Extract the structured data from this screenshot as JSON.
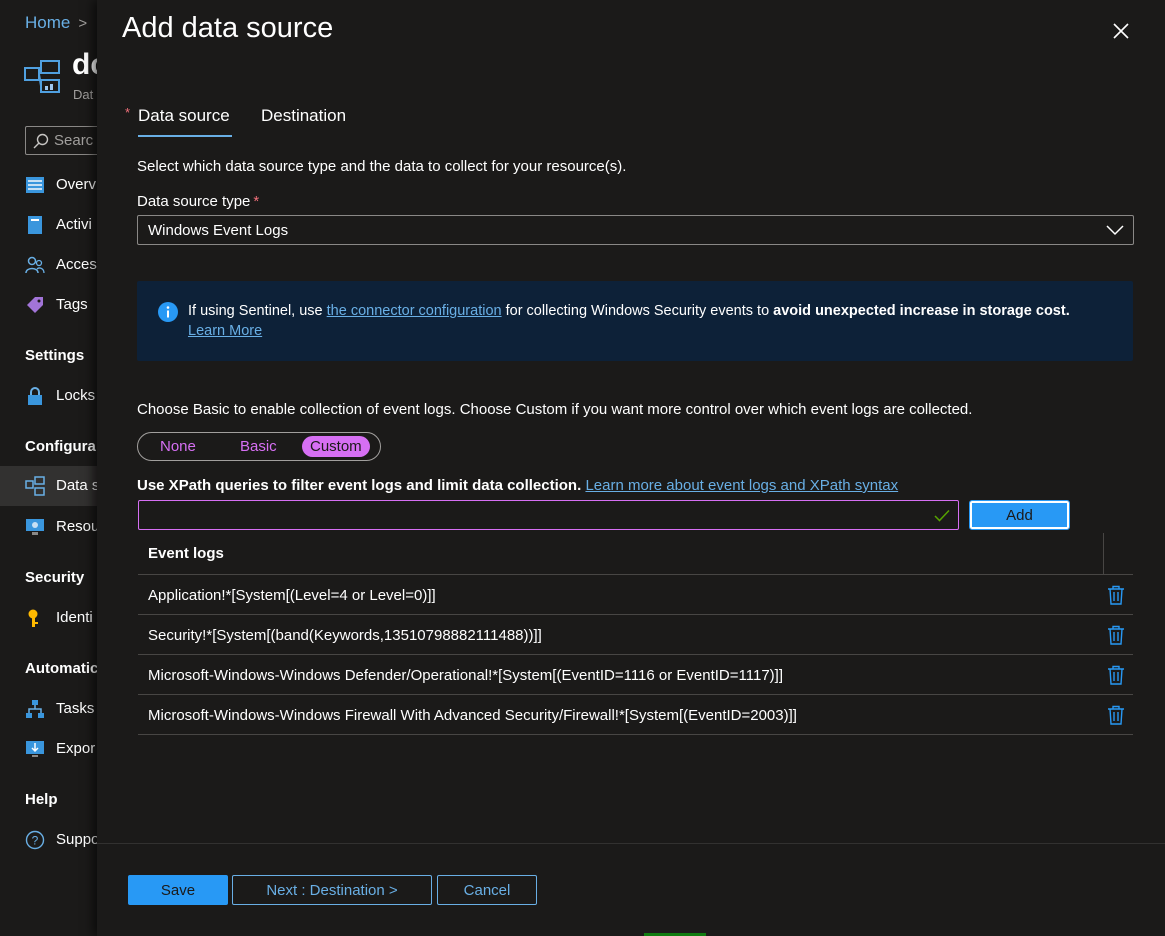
{
  "background": {
    "breadcrumb": "Home",
    "resource_title": "dc",
    "resource_subtitle": "Dat",
    "search_placeholder": "Searc",
    "nav": {
      "overview": "Overv",
      "activity": "Activi",
      "access": "Acces",
      "tags": "Tags",
      "settings_header": "Settings",
      "locks": "Locks",
      "configuration_header": "Configura",
      "data_sources": "Data s",
      "resources": "Resou",
      "security_header": "Security",
      "identity": "Identi",
      "automation_header": "Automatic",
      "tasks": "Tasks",
      "export": "Expor",
      "help_header": "Help",
      "support": "Suppo"
    }
  },
  "panel": {
    "title": "Add data source",
    "tabs": {
      "data_source": "Data source",
      "destination": "Destination"
    },
    "description": "Select which data source type and the data to collect for your resource(s).",
    "data_source_type_label": "Data source type",
    "required_marker": "*",
    "data_source_type_value": "Windows Event Logs",
    "info": {
      "prefix": "If using Sentinel, use ",
      "link": "the connector configuration",
      "middle": " for collecting Windows Security events to ",
      "bold": "avoid unexpected increase in storage cost.",
      "learn_more": "Learn More"
    },
    "choose_text": "Choose Basic to enable collection of event logs. Choose Custom if you want more control over which event logs are collected.",
    "collection_mode": {
      "options": [
        "None",
        "Basic",
        "Custom"
      ],
      "selected": "Custom"
    },
    "xpath": {
      "label": "Use XPath queries to filter event logs and limit data collection.",
      "link": "Learn more about event logs and XPath syntax",
      "value": "",
      "add_label": "Add"
    },
    "table": {
      "header": "Event logs",
      "rows": [
        "Application!*[System[(Level=4 or Level=0)]]",
        "Security!*[System[(band(Keywords,13510798882111488))]]",
        "Microsoft-Windows-Windows Defender/Operational!*[System[(EventID=1116 or EventID=1117)]]",
        "Microsoft-Windows-Windows Firewall With Advanced Security/Firewall!*[System[(EventID=2003)]]"
      ]
    },
    "buttons": {
      "save": "Save",
      "next": "Next : Destination >",
      "cancel": "Cancel"
    }
  },
  "colors": {
    "accent": "#2899f5",
    "link": "#69afe5",
    "custom_purple": "#d66ff3",
    "info_bg": "#0d2138",
    "required": "#f1707b"
  }
}
